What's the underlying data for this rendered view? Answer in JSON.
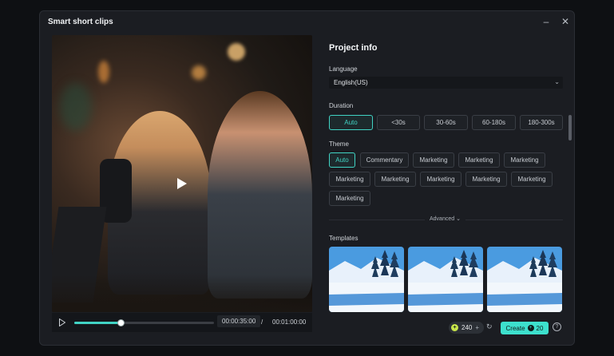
{
  "window": {
    "title": "Smart short clips",
    "minimize_icon": "minimize-icon",
    "close_icon": "close-icon"
  },
  "player": {
    "current_time": "00:00:35:00",
    "separator": "/",
    "total_time": "00:01:00:00",
    "progress": 0.33,
    "play_icon": "play-icon"
  },
  "project": {
    "heading": "Project info",
    "language": {
      "label": "Language",
      "value": "English(US)"
    },
    "duration": {
      "label": "Duration",
      "options": [
        "Auto",
        "<30s",
        "30-60s",
        "60-180s",
        "180-300s"
      ],
      "selected": "Auto"
    },
    "theme": {
      "label": "Theme",
      "options": [
        "Auto",
        "Commentary",
        "Marketing",
        "Marketing",
        "Marketing",
        "Marketing",
        "Marketing",
        "Marketing",
        "Marketing",
        "Marketing",
        "Marketing"
      ],
      "selected": "Auto"
    },
    "advanced": "Advanced",
    "templates": {
      "label": "Templates"
    }
  },
  "footer": {
    "credits": "240",
    "credits_plus": "+",
    "create_label": "Create",
    "create_cost": "20",
    "help": "?"
  },
  "colors": {
    "accent": "#41d3c4",
    "background": "#1b1d22"
  }
}
